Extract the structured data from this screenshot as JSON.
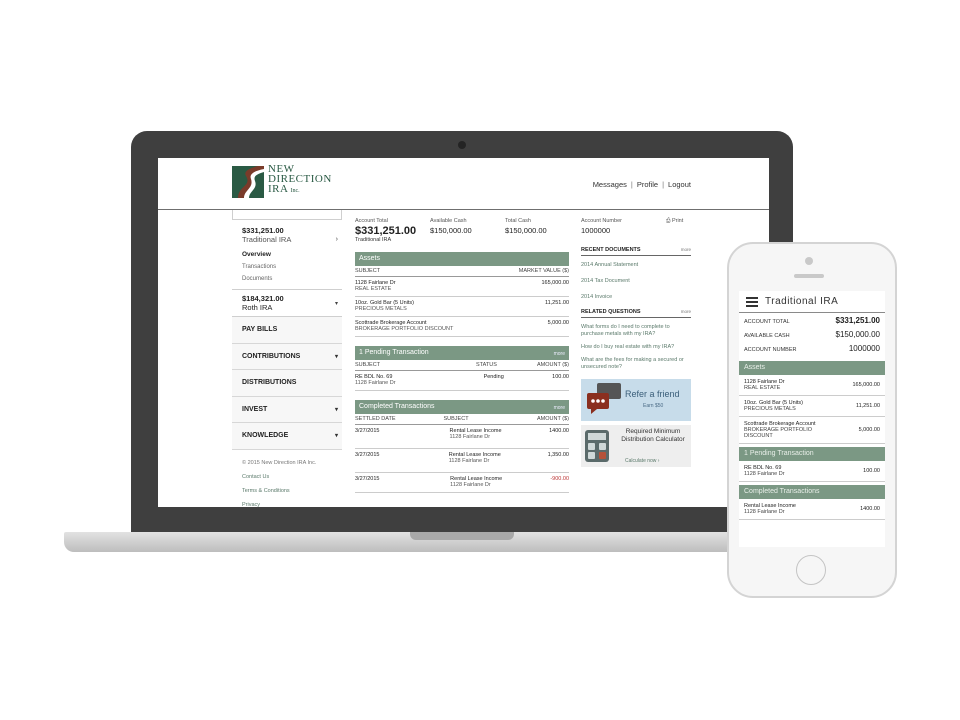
{
  "brand": {
    "line1": "NEW",
    "line2": "DIRECTION",
    "line3": "IRA",
    "inc": "Inc."
  },
  "top_nav": {
    "messages": "Messages",
    "profile": "Profile",
    "logout": "Logout",
    "sep": "|"
  },
  "sidebar": {
    "account1": {
      "amount": "$331,251.00",
      "name": "Traditional IRA",
      "chevron": "›"
    },
    "sub_links": {
      "overview": "Overview",
      "transactions": "Transactions",
      "documents": "Documents"
    },
    "account2": {
      "amount": "$184,321.00",
      "name": "Roth IRA"
    },
    "items": [
      {
        "label": "PAY BILLS",
        "caret": ""
      },
      {
        "label": "CONTRIBUTIONS",
        "caret": "▾"
      },
      {
        "label": "DISTRIBUTIONS",
        "caret": ""
      },
      {
        "label": "INVEST",
        "caret": "▾"
      },
      {
        "label": "KNOWLEDGE",
        "caret": "▾"
      }
    ],
    "footer": {
      "copyright": "© 2015 New Direction IRA Inc.",
      "contact": "Contact Us",
      "terms": "Terms & Conditions",
      "privacy": "Privacy"
    }
  },
  "summary": {
    "account_total_label": "Account Total",
    "account_total": "$331,251.00",
    "account_type": "Traditional IRA",
    "available_cash_label": "Available Cash",
    "available_cash": "$150,000.00",
    "total_cash_label": "Total Cash",
    "total_cash": "$150,000.00",
    "account_number_label": "Account Number",
    "account_number": "1000000",
    "print": "Print"
  },
  "assets": {
    "title": "Assets",
    "col_subject": "SUBJECT",
    "col_value": "MARKET VALUE ($)",
    "rows": [
      {
        "line1": "1128 Fairlane Dr",
        "line2": "REAL ESTATE",
        "value": "165,000.00"
      },
      {
        "line1": "10oz. Gold Bar (5 Units)",
        "line2": "PRECIOUS METALS",
        "value": "11,251.00"
      },
      {
        "line1": "Scottrade Brokerage Account",
        "line2": "BROKERAGE PORTFOLIO DISCOUNT",
        "value": "5,000.00"
      }
    ]
  },
  "pending": {
    "title": "1 Pending Transaction",
    "more": "more",
    "col_subject": "SUBJECT",
    "col_status": "STATUS",
    "col_amount": "AMOUNT ($)",
    "rows": [
      {
        "line1": "RE BDL No. 69",
        "line2": "1128 Fairlane Dr",
        "status": "Pending",
        "amount": "100.00"
      }
    ]
  },
  "completed": {
    "title": "Completed Transactions",
    "more": "more",
    "col_date": "SETTLED DATE",
    "col_subject": "SUBJECT",
    "col_amount": "AMOUNT ($)",
    "rows": [
      {
        "date": "3/27/2015",
        "line1": "Rental Lease Income",
        "line2": "1128 Fairlane Dr",
        "amount": "1400.00"
      },
      {
        "date": "3/27/2015",
        "line1": "Rental Lease Income",
        "line2": "1128 Fairlane Dr",
        "amount": "1,350.00"
      },
      {
        "date": "3/27/2015",
        "line1": "Rental Lease Income",
        "line2": "1128 Fairlane Dr",
        "amount": "-900.00"
      }
    ]
  },
  "documents": {
    "title": "RECENT DOCUMENTS",
    "more": "more",
    "items": [
      "2014 Annual Statement",
      "2014 Tax Document",
      "2014 Invoice"
    ]
  },
  "questions": {
    "title": "RELATED QUESTIONS",
    "more": "more",
    "items": [
      "What forms do I need to complete to purchase metals with my IRA?",
      "How do I buy real estate with my IRA?",
      "What are the fees for making a secured or unsecured note?"
    ]
  },
  "refer": {
    "title": "Refer a friend",
    "sub": "Earn $50"
  },
  "calculator": {
    "title": "Required Minimum Distribution Calculator",
    "cta": "Calculate now ›"
  },
  "mobile": {
    "title": "Traditional IRA",
    "account_total_label": "ACCOUNT TOTAL",
    "account_total": "$331,251.00",
    "available_cash_label": "AVAILABLE CASH",
    "available_cash": "$150,000.00",
    "account_number_label": "ACCOUNT NUMBER",
    "account_number": "1000000",
    "assets_title": "Assets",
    "assets": [
      {
        "line1": "1128 Fairlane Dr",
        "line2": "REAL ESTATE",
        "value": "165,000.00"
      },
      {
        "line1": "10oz. Gold Bar (5 Units)",
        "line2": "PRECIOUS METALS",
        "value": "11,251.00"
      },
      {
        "line1": "Scottrade Brokerage Account",
        "line2": "BROKERAGE PORTFOLIO DISCOUNT",
        "value": "5,000.00"
      }
    ],
    "pending_title": "1 Pending Transaction",
    "pending": {
      "line1": "RE BDL No. 69",
      "line2": "1128 Fairlane Dr",
      "value": "100.00"
    },
    "completed_title": "Completed Transactions",
    "completed": {
      "line1": "Rental Lease Income",
      "line2": "1128 Fairlane Dr",
      "value": "1400.00"
    }
  },
  "colors": {
    "accent_green": "#7b9884",
    "brand_green": "#2a5a44",
    "link_green": "#5b7a6b",
    "negative": "#b33333",
    "refer_bg": "#c7dcea"
  }
}
